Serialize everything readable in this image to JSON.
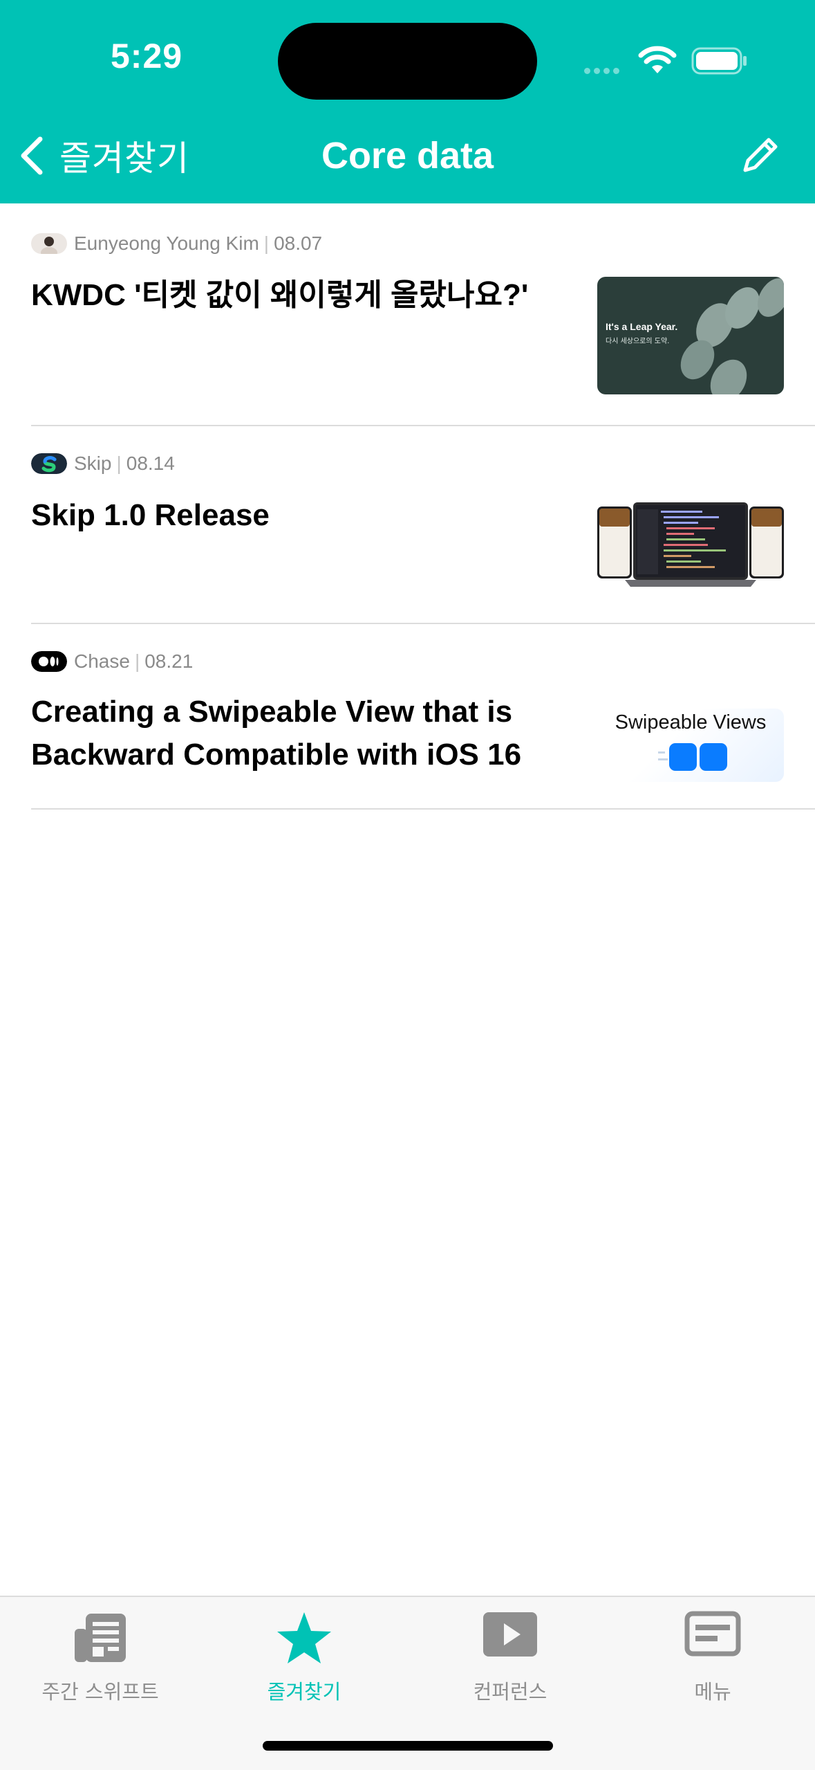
{
  "status_bar": {
    "time": "5:29"
  },
  "nav": {
    "back_label": "즐겨찾기",
    "title": "Core data"
  },
  "colors": {
    "accent": "#00C2B5",
    "inactive": "#8f8f8f",
    "divider": "#dcdcdc"
  },
  "articles": [
    {
      "author": "Eunyeong Young Kim",
      "date": "08.07",
      "title": "KWDC '티켓 값이 왜이렇게 올랐나요?'",
      "thumb": {
        "headline": "It's a Leap Year.",
        "sub": "다시 세상으로의 도약."
      }
    },
    {
      "author": "Skip",
      "date": "08.14",
      "title": "Skip 1.0 Release"
    },
    {
      "author": "Chase",
      "date": "08.21",
      "title": "Creating a Swipeable View that is Backward Compatible with iOS 16",
      "thumb": {
        "caption": "Swipeable Views"
      }
    }
  ],
  "tabs": [
    {
      "label": "주간 스위프트",
      "icon": "newspaper-icon",
      "active": false
    },
    {
      "label": "즐겨찾기",
      "icon": "star-icon",
      "active": true
    },
    {
      "label": "컨퍼런스",
      "icon": "play-icon",
      "active": false
    },
    {
      "label": "메뉴",
      "icon": "menu-card-icon",
      "active": false
    }
  ]
}
